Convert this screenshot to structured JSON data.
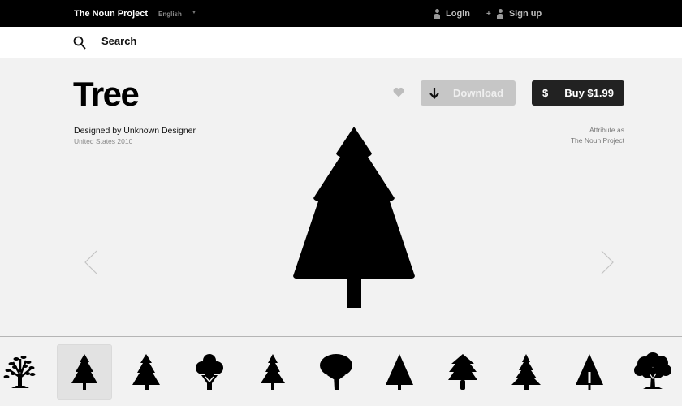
{
  "header": {
    "brand": "The Noun Project",
    "language": "English",
    "login": "Login",
    "signup_plus": "+",
    "signup": "Sign up"
  },
  "search": {
    "label": "Search"
  },
  "icon": {
    "title": "Tree",
    "designer": "Designed by Unknown Designer",
    "meta": "United States 2010",
    "attribute_label": "Attribute as",
    "attribute_value": "The Noun Project"
  },
  "actions": {
    "download": "Download",
    "buy_symbol": "$",
    "buy": "Buy $1.99"
  },
  "colors": {
    "topbar": "#000000",
    "download_bg": "#c6c6c6",
    "buy_bg": "#222222"
  },
  "related": [
    {
      "name": "leafy-tree-icon",
      "selected": false
    },
    {
      "name": "pine-tree-icon",
      "selected": true
    },
    {
      "name": "pine-tree-icon",
      "selected": false
    },
    {
      "name": "broccoli-tree-icon",
      "selected": false
    },
    {
      "name": "small-pine-icon",
      "selected": false
    },
    {
      "name": "round-tree-icon",
      "selected": false
    },
    {
      "name": "cone-tree-icon",
      "selected": false
    },
    {
      "name": "fir-tree-icon",
      "selected": false
    },
    {
      "name": "spruce-tree-icon",
      "selected": false
    },
    {
      "name": "split-cone-tree-icon",
      "selected": false
    },
    {
      "name": "oak-tree-icon",
      "selected": false
    }
  ]
}
